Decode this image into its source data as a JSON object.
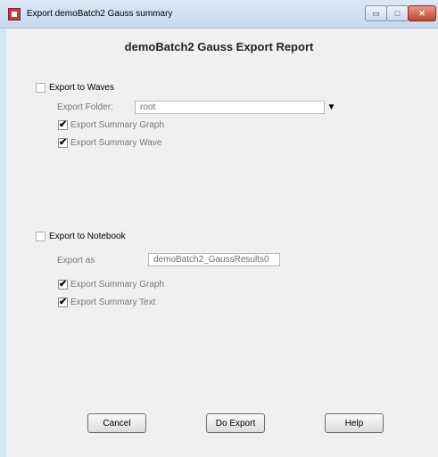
{
  "window": {
    "title": "Export demoBatch2 Gauss summary",
    "minimize_glyph": "▭",
    "maximize_glyph": "□",
    "close_glyph": "✕"
  },
  "report_title": "demoBatch2 Gauss Export Report",
  "waves": {
    "label": "Export to Waves",
    "checked": false,
    "folder_label": "Export Folder:",
    "folder_value": "root",
    "dropdown_glyph": "▼",
    "summary_graph": {
      "label": "Export Summary Graph",
      "checked": true
    },
    "summary_wave": {
      "label": "Export Summary Wave",
      "checked": true
    }
  },
  "notebook": {
    "label": "Export to Notebook",
    "checked": false,
    "export_as_label": "Export as",
    "export_as_value": "demoBatch2_GaussResults0",
    "summary_graph": {
      "label": "Export Summary Graph",
      "checked": true
    },
    "summary_text": {
      "label": "Export Summary Text",
      "checked": true
    }
  },
  "buttons": {
    "cancel": "Cancel",
    "do_export": "Do Export",
    "help": "Help"
  },
  "check_glyph": "✔"
}
